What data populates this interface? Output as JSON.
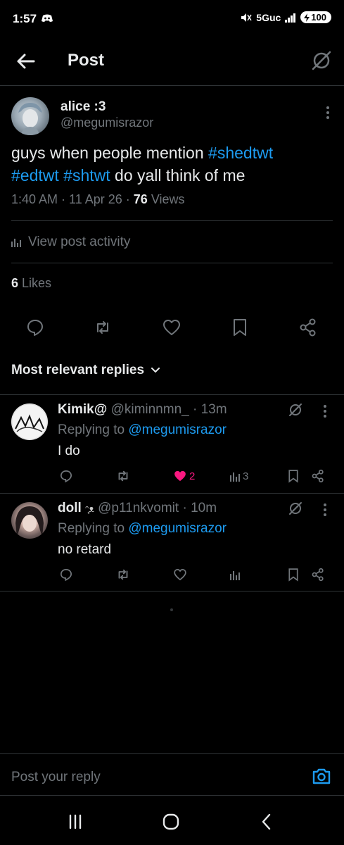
{
  "status_bar": {
    "time": "1:57",
    "network": "5Guc",
    "battery": "100"
  },
  "header": {
    "title": "Post"
  },
  "post": {
    "author_name": "alice :3",
    "author_handle": "@megumisrazor",
    "text_plain_1": "guys when people mention ",
    "tag_1": "#shedtwt",
    "tag_2": "#edtwt",
    "tag_3": "#shtwt",
    "text_plain_2": " do yall think of me",
    "time": "1:40 AM",
    "date": "11 Apr 26",
    "views_count": "76",
    "views_label": "Views",
    "activity_label": "View post activity",
    "likes_count": "6",
    "likes_label": "Likes"
  },
  "replies_section": {
    "heading": "Most relevant replies"
  },
  "replies": [
    {
      "name": "Kimik@",
      "handle": "@kiminnmn_",
      "age": "13m",
      "replying_prefix": "Replying to",
      "replying_to": "@megumisrazor",
      "text": "I do",
      "likes": "2",
      "views": "3"
    },
    {
      "name": "doll",
      "name_emoji": "ᵔ̥ᴥ",
      "handle": "@p11nkvomit",
      "age": "10m",
      "replying_prefix": "Replying to",
      "replying_to": "@megumisrazor",
      "text": "no retard",
      "likes": "",
      "views": ""
    }
  ],
  "compose": {
    "placeholder": "Post your reply"
  },
  "colors": {
    "background": "#000000",
    "accent": "#1d9bf0",
    "like": "#f91880",
    "muted": "#71767b",
    "text": "#e7e9ea",
    "border": "#2f3336"
  }
}
